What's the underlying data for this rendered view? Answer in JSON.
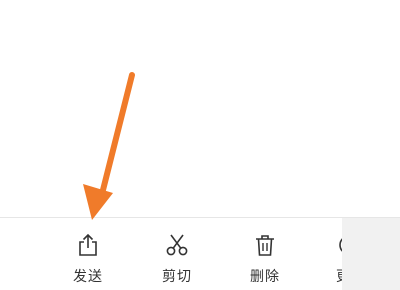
{
  "toolbar": {
    "items": [
      {
        "label": "发送",
        "icon": "share-upload-icon"
      },
      {
        "label": "剪切",
        "icon": "scissors-icon"
      },
      {
        "label": "删除",
        "icon": "trash-icon"
      },
      {
        "label": "更",
        "icon": "more-icon"
      }
    ]
  },
  "annotation": {
    "arrow_color": "#f07b2a",
    "points_to": "发送"
  },
  "colors": {
    "icon": "#333333",
    "divider": "#e6e6e6",
    "background": "#ffffff"
  }
}
